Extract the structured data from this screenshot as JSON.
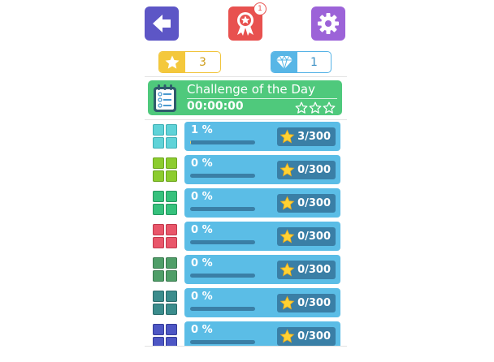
{
  "header": {
    "back_icon": "arrow-left-icon",
    "award_icon": "ribbon-award-icon",
    "award_badge": "1",
    "settings_icon": "gear-icon",
    "colors": {
      "back": "#5d56c6",
      "award": "#e8514f",
      "settings": "#9c63d8"
    }
  },
  "counters": {
    "stars": {
      "icon": "star-icon",
      "value": "3",
      "color": "#f4c83c"
    },
    "gems": {
      "icon": "diamond-icon",
      "value": "1",
      "color": "#58b6e6"
    }
  },
  "challenge": {
    "title": "Challenge of the Day",
    "time": "00:00:00",
    "stars_earned": 0,
    "stars_total": 3,
    "icon": "checklist-clipboard-icon",
    "color": "#4fc97c"
  },
  "levels": [
    {
      "percent_label": "1 %",
      "progress": 0.01,
      "score": "3/300",
      "color": "#5fd3d8",
      "dark": "#3eaeb3"
    },
    {
      "percent_label": "0 %",
      "progress": 0,
      "score": "0/300",
      "color": "#8ccc2e",
      "dark": "#6da51f"
    },
    {
      "percent_label": "0 %",
      "progress": 0,
      "score": "0/300",
      "color": "#36c17c",
      "dark": "#25975f"
    },
    {
      "percent_label": "0 %",
      "progress": 0,
      "score": "0/300",
      "color": "#e9566a",
      "dark": "#c13a4d"
    },
    {
      "percent_label": "0 %",
      "progress": 0,
      "score": "0/300",
      "color": "#4f9e68",
      "dark": "#3a7a4f"
    },
    {
      "percent_label": "0 %",
      "progress": 0,
      "score": "0/300",
      "color": "#3b8c8c",
      "dark": "#2b6b6b"
    },
    {
      "percent_label": "0 %",
      "progress": 0,
      "score": "0/300",
      "color": "#4d56c4",
      "dark": "#363d99"
    }
  ]
}
